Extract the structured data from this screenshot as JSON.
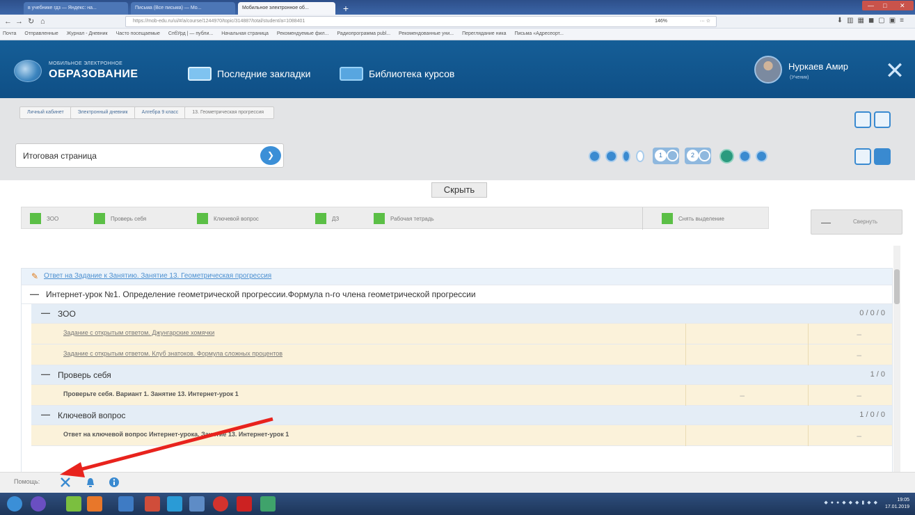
{
  "browser": {
    "tabs": [
      {
        "label": "в учебнике гдз — Яндекс: на..."
      },
      {
        "label": "Письма (Все письма) — Мо..."
      },
      {
        "label": "Мобильное электронное об..."
      }
    ],
    "url": "https://mob-edu.ru/ui/#/a/course/1244970/topic/314887/total/student/a=1088401",
    "zoom": "146%",
    "bookmarks": [
      "Почта",
      "Отправленные",
      "Журнал - Дневник",
      "Часто посещаемые",
      "СпбУрд | — публи...",
      "Начальная страница",
      "Рекомендуемые фил...",
      "Радиопрограмма publ...",
      "Рекомендованные уни...",
      "Переглядание ника",
      "Письма «Адресеорт..."
    ]
  },
  "header": {
    "logo_small": "МОБИЛЬНОЕ ЭЛЕКТРОННОЕ",
    "logo_big": "ОБРАЗОВАНИЕ",
    "link_bookmarks": "Последние закладки",
    "link_library": "Библиотека курсов",
    "user_name": "Нуркаев Амир",
    "user_role": "(Ученик)",
    "close_glyph": "✕"
  },
  "breadcrumbs": [
    "Личный кабинет",
    "Электронный дневник",
    "Алгебра 9 класс",
    "13. Геометрическая прогрессия"
  ],
  "page_select": {
    "value": "Итоговая страница",
    "arrow": "❯"
  },
  "pager": {
    "box1": "1",
    "box2": "2"
  },
  "hide_button": "Скрыть",
  "filters": [
    "ЗОО",
    "Проверь себя",
    "Ключевой вопрос",
    "ДЗ",
    "Рабочая тетрадь"
  ],
  "clear_highlight": "Снять выделение",
  "collapse_button": {
    "glyph": "—",
    "label": "Свернуть"
  },
  "tree": {
    "answer_link": "Ответ на Задание к Занятию. Занятие 13. Геометрическая прогрессия",
    "lesson": "Интернет-урок №1. Определение геометрической прогрессии.Формула n-го члена геометрической прогрессии",
    "dash": "—",
    "groups": [
      {
        "label": "ЗОО",
        "count": "0 / 0 / 0"
      },
      {
        "label": "Проверь себя",
        "count": "1 / 0"
      },
      {
        "label": "Ключевой вопрос",
        "count": "1 / 0 / 0"
      }
    ],
    "tasks": [
      {
        "label": "Задание с открытым ответом. Джунгарские хомячки",
        "c2": "–"
      },
      {
        "label": "Задание с открытым ответом. Клуб знатоков. Формула сложных процентов",
        "c2": "–"
      },
      {
        "label": "Проверьте себя. Вариант 1. Занятие 13. Интернет-урок 1",
        "c1": "–",
        "c2": "–"
      },
      {
        "label": "Ответ на ключевой вопрос Интернет-урока. Занятие 13. Интернет-урок 1",
        "c2": "–"
      }
    ]
  },
  "help": {
    "label": "Помощь:"
  },
  "taskbar": {
    "time": "19:05",
    "date": "17.01.2019"
  },
  "colors": {
    "accent": "#1565a2",
    "green": "#5bbf46",
    "arrow": "#e8231d"
  }
}
